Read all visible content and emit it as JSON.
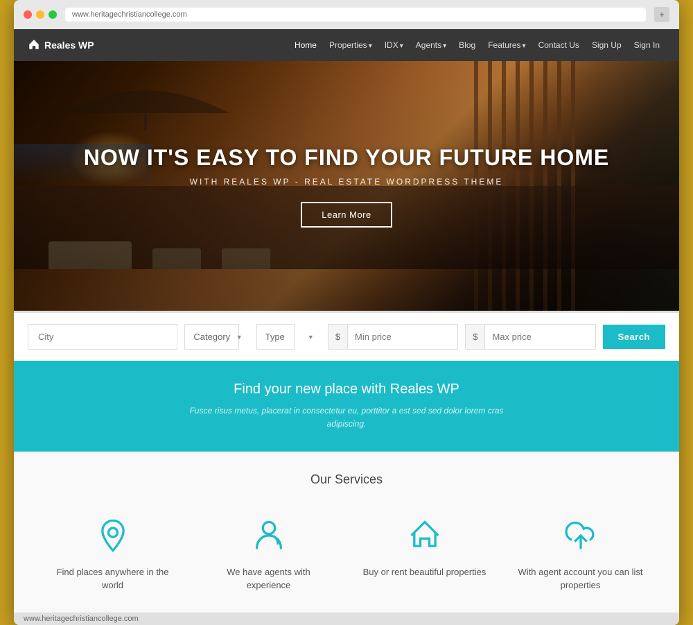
{
  "browser": {
    "address": "www.heritagechristiancollege.com",
    "expand_label": "+"
  },
  "navbar": {
    "brand": "Reales WP",
    "links": [
      {
        "label": "Home",
        "has_dropdown": false
      },
      {
        "label": "Properties",
        "has_dropdown": true
      },
      {
        "label": "IDX",
        "has_dropdown": true
      },
      {
        "label": "Agents",
        "has_dropdown": true
      },
      {
        "label": "Blog",
        "has_dropdown": false
      },
      {
        "label": "Features",
        "has_dropdown": true
      },
      {
        "label": "Contact Us",
        "has_dropdown": false
      },
      {
        "label": "Sign Up",
        "has_dropdown": false
      },
      {
        "label": "Sign In",
        "has_dropdown": false
      }
    ]
  },
  "hero": {
    "title": "NOW IT'S EASY TO FIND YOUR FUTURE HOME",
    "subtitle": "WITH REALES WP - REAL ESTATE WORDPRESS THEME",
    "cta_label": "Learn More"
  },
  "search": {
    "city_placeholder": "City",
    "category_label": "Category",
    "type_label": "Type",
    "min_price_placeholder": "Min price",
    "max_price_placeholder": "Max price",
    "currency_symbol": "$",
    "search_button": "Search"
  },
  "teal_banner": {
    "title": "Find your new place with Reales WP",
    "subtitle": "Fusce risus metus, placerat in consectetur eu, porttitor a est sed sed dolor lorem cras adipiscing."
  },
  "services": {
    "title": "Our Services",
    "items": [
      {
        "icon": "location-pin",
        "label": "Find places anywhere in the world"
      },
      {
        "icon": "agent-person",
        "label": "We have agents with experience"
      },
      {
        "icon": "house",
        "label": "Buy or rent beautiful properties"
      },
      {
        "icon": "cloud-upload",
        "label": "With agent account you can list properties"
      }
    ]
  },
  "status_bar": {
    "url": "www.heritagechristiancollege.com"
  }
}
